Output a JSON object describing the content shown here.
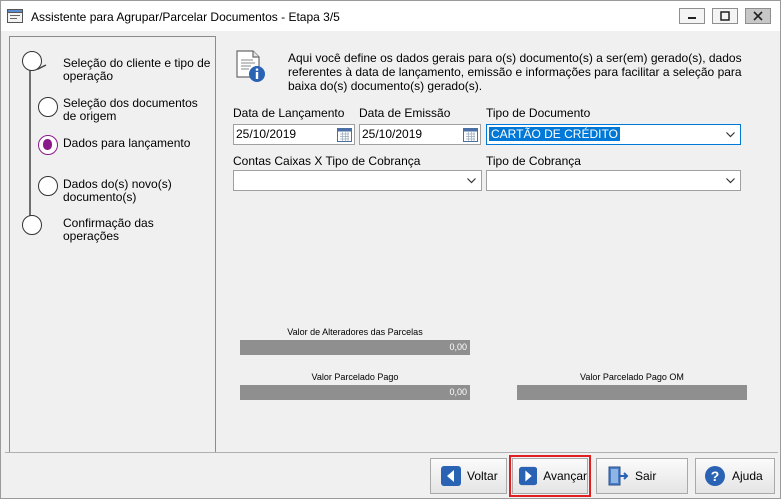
{
  "window": {
    "title": "Assistente para Agrupar/Parcelar Documentos - Etapa 3/5",
    "minimize_label": "",
    "maximize_label": "",
    "close_label": ""
  },
  "steps": [
    {
      "label": "Seleção do cliente e tipo de operação",
      "state": "done"
    },
    {
      "label": "Seleção dos documentos de origem",
      "state": "done"
    },
    {
      "label": "Dados para lançamento",
      "state": "active"
    },
    {
      "label": "Dados do(s) novo(s) documento(s)",
      "state": "pending"
    },
    {
      "label": "Confirmação das operações",
      "state": "pending"
    }
  ],
  "info": {
    "text": "Aqui você define os dados gerais para o(s) documento(s) a ser(em) gerado(s), dados referentes à data de lançamento, emissão e informações para facilitar a seleção para baixa do(s) documento(s) gerado(s)."
  },
  "form": {
    "data_lancamento_label": "Data de Lançamento",
    "data_lancamento_value": "25/10/2019",
    "data_emissao_label": "Data de Emissão",
    "data_emissao_value": "25/10/2019",
    "tipo_documento_label": "Tipo de Documento",
    "tipo_documento_value": "CARTÃO DE CRÉDITO",
    "contas_caixas_label": "Contas Caixas X Tipo de Cobrança",
    "contas_caixas_value": "",
    "tipo_cobranca_label": "Tipo de Cobrança",
    "tipo_cobranca_value": ""
  },
  "summary": {
    "alteradores_label": "Valor de Alteradores das Parcelas",
    "alteradores_value": "0,00",
    "parcelado_pago_label": "Valor Parcelado Pago",
    "parcelado_pago_value": "0,00",
    "parcelado_pago_om_label": "Valor Parcelado Pago OM",
    "parcelado_pago_om_value": ""
  },
  "buttons": {
    "voltar": "Voltar",
    "avancar": "Avançar",
    "sair": "Sair",
    "ajuda": "Ajuda"
  },
  "colors": {
    "accent_blue": "#2a62b4",
    "selection": "#0078d7",
    "highlight_red": "#e02020",
    "active_step": "#8a1a8a"
  }
}
